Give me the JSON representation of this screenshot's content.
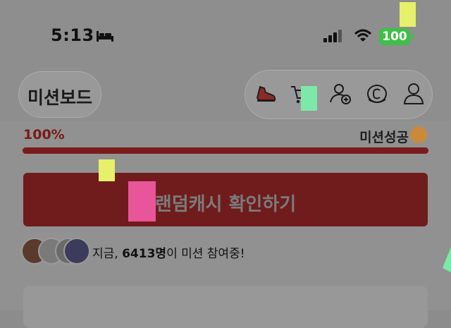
{
  "status_bar": {
    "time": "5:13",
    "battery": "100"
  },
  "header": {
    "title": "미션보드",
    "icons": [
      "shoe-icon",
      "cart-icon",
      "add-user-icon",
      "coin-icon",
      "profile-icon"
    ]
  },
  "progress": {
    "percent_label": "100%",
    "value": 1.0,
    "status": "미션성공"
  },
  "cta": {
    "label": "랜덤캐시 확인하기"
  },
  "participants": {
    "prefix": "지금, ",
    "count": "6413명",
    "suffix": "이 미션 참여중!"
  },
  "colors": {
    "accent": "#701c1c",
    "battery": "#3fbf48",
    "overlay_yellow": "#e6f06a",
    "overlay_green": "#7ee8a8",
    "overlay_pink": "#e8559a"
  }
}
